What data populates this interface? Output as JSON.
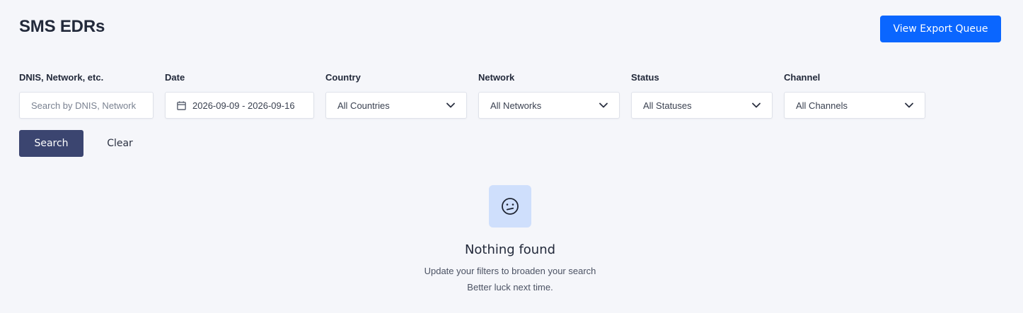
{
  "header": {
    "title": "SMS EDRs",
    "export_button": "View Export Queue"
  },
  "filters": {
    "search": {
      "label": "DNIS, Network, etc.",
      "placeholder": "Search by DNIS, Network",
      "value": ""
    },
    "date": {
      "label": "Date",
      "value": "2026-09-09 - 2026-09-16",
      "icon": "calendar-icon"
    },
    "country": {
      "label": "Country",
      "value": "All Countries",
      "icon": "chevron-down-icon"
    },
    "network": {
      "label": "Network",
      "value": "All Networks",
      "icon": "chevron-down-icon"
    },
    "status": {
      "label": "Status",
      "value": "All Statuses",
      "icon": "chevron-down-icon"
    },
    "channel": {
      "label": "Channel",
      "value": "All Channels",
      "icon": "chevron-down-icon"
    }
  },
  "actions": {
    "search_label": "Search",
    "clear_label": "Clear"
  },
  "empty_state": {
    "icon": "sad-face-icon",
    "title": "Nothing found",
    "line1": "Update your filters to broaden your search",
    "line2": "Better luck next time."
  },
  "colors": {
    "primary": "#0a66ff",
    "search_button": "#3b4570",
    "empty_icon_bg": "#cfdffc",
    "background": "#f5f6fa"
  }
}
